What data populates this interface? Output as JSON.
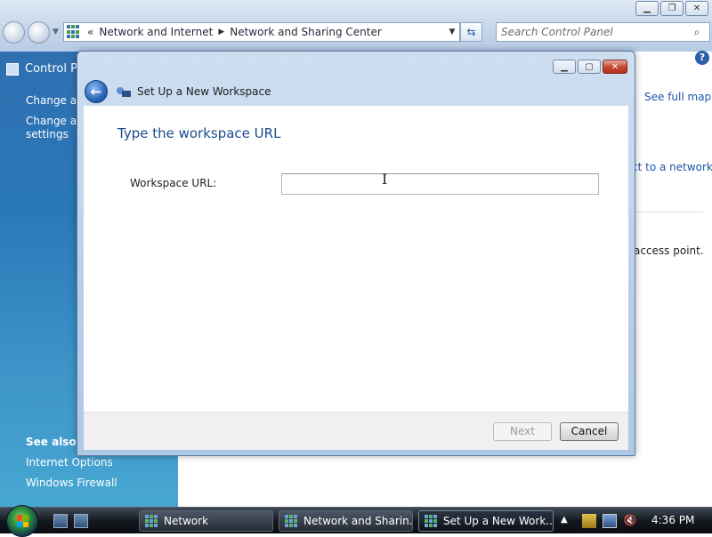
{
  "explorer": {
    "breadcrumb": {
      "overflow": "«",
      "items": [
        "Network and Internet",
        "Network and Sharing Center"
      ]
    },
    "search": {
      "placeholder": "Search Control Panel"
    },
    "left_pane": {
      "title": "Control Pa",
      "links": [
        "Change ad",
        "Change ad",
        "settings"
      ],
      "see_also_title": "See also",
      "see_also_links": [
        "Internet Options",
        "Windows Firewall"
      ]
    },
    "right_pane": {
      "see_full_map": "See full map",
      "connect_link": "ct to a network",
      "access_text": "access point."
    },
    "help_label": "?"
  },
  "dialog": {
    "title": "Set Up a New Workspace",
    "main_instruction": "Type the workspace URL",
    "field_label": "Workspace URL:",
    "url_value": "",
    "next_label": "Next",
    "next_enabled": false,
    "cancel_label": "Cancel"
  },
  "taskbar": {
    "buttons": [
      {
        "label": "Network",
        "active": false
      },
      {
        "label": "Network and Sharin...",
        "active": false
      },
      {
        "label": "Set Up a New Work...",
        "active": true
      }
    ],
    "clock": "4:36 PM"
  },
  "colors": {
    "accent_blue": "#1b4a8c",
    "link_blue": "#1a57a8",
    "close_red": "#c5442f"
  }
}
